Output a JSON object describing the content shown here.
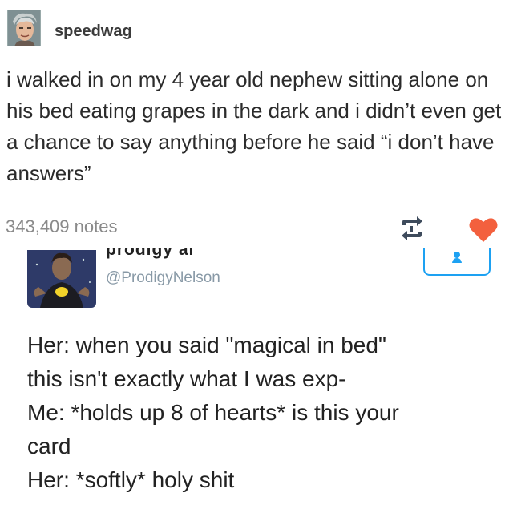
{
  "post": {
    "username": "speedwag",
    "avatar_icon": "avatar-icon",
    "text": "i walked in on my 4 year old nephew sitting alone on his bed eating grapes in the dark and i didn’t even get a chance to say anything before he said “i don’t have answers”",
    "notes": "343,409 notes",
    "reblog_icon": "reblog-icon",
    "like_icon": "heart-icon",
    "like_color": "#f3603e"
  },
  "tweet": {
    "display_name": "prodigy al",
    "handle": "@ProdigyNelson",
    "accent_color": "#1da1f2",
    "lines": [
      "Her: when you said \"magical in bed\"",
      "this isn't exactly what I was exp-",
      "Me: *holds up 8 of hearts* is this your",
      "card",
      "Her: *softly* holy shit"
    ]
  }
}
